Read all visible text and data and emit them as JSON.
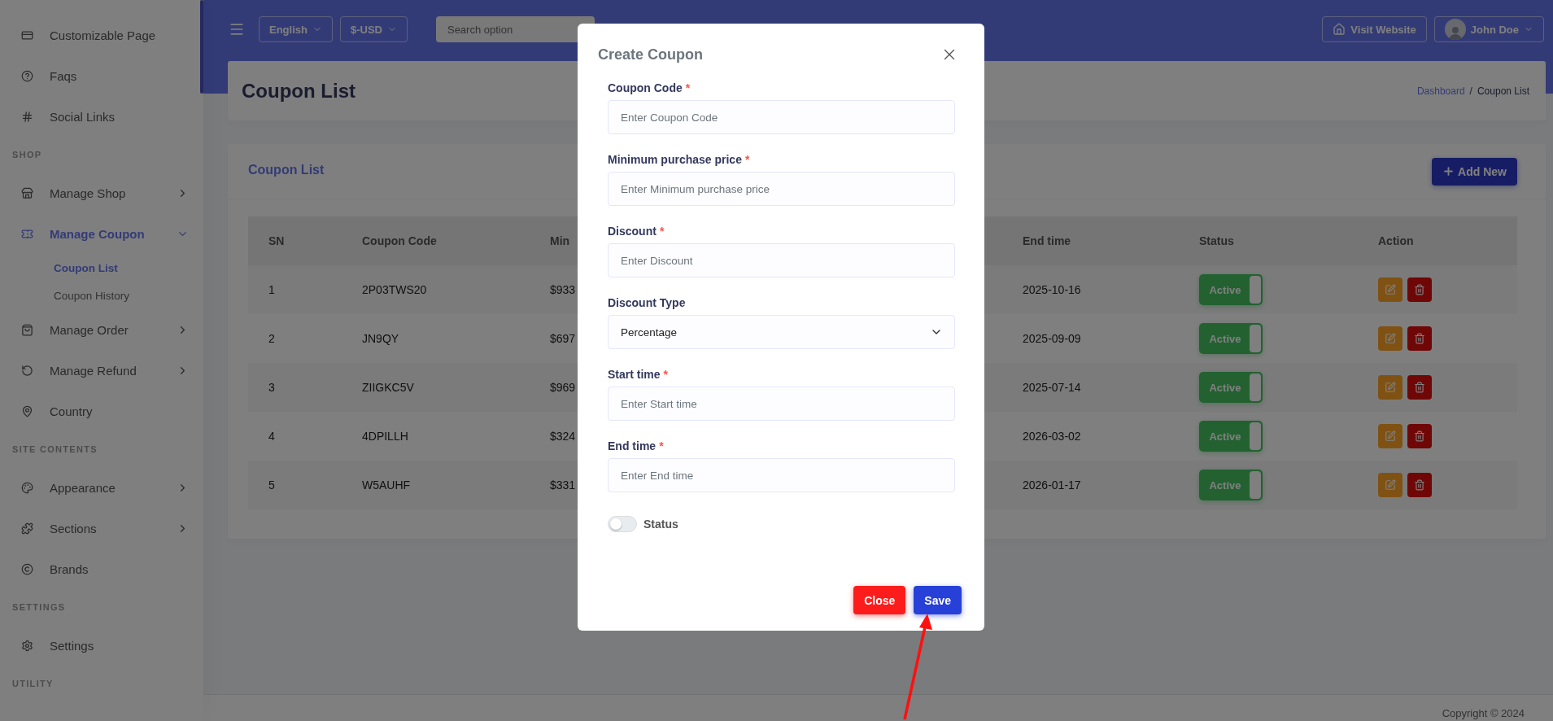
{
  "sidebar": {
    "items": [
      {
        "kind": "item",
        "label": "Customizable Page",
        "selected": false
      },
      {
        "kind": "item",
        "label": "Faqs",
        "selected": false
      },
      {
        "kind": "item",
        "label": "Social Links",
        "selected": false
      },
      {
        "kind": "heading",
        "label": "SHOP"
      },
      {
        "kind": "item",
        "label": "Manage Shop",
        "selected": false,
        "expanded": false
      },
      {
        "kind": "item",
        "label": "Manage Coupon",
        "selected": true,
        "expanded": true,
        "children": [
          {
            "label": "Coupon List",
            "selected": true
          },
          {
            "label": "Coupon History",
            "selected": false
          }
        ]
      },
      {
        "kind": "item",
        "label": "Manage Order",
        "selected": false,
        "expanded": false
      },
      {
        "kind": "item",
        "label": "Manage Refund",
        "selected": false,
        "expanded": false
      },
      {
        "kind": "item",
        "label": "Country",
        "selected": false
      },
      {
        "kind": "heading",
        "label": "SITE CONTENTS"
      },
      {
        "kind": "item",
        "label": "Appearance",
        "selected": false,
        "expanded": false
      },
      {
        "kind": "item",
        "label": "Sections",
        "selected": false,
        "expanded": false
      },
      {
        "kind": "item",
        "label": "Brands",
        "selected": false
      },
      {
        "kind": "heading",
        "label": "SETTINGS"
      },
      {
        "kind": "item",
        "label": "Settings",
        "selected": false
      },
      {
        "kind": "heading",
        "label": "UTILITY"
      }
    ]
  },
  "topbar": {
    "language": "English",
    "currency": "$-USD",
    "search": {
      "placeholder": "Search option"
    },
    "visit_website": "Visit Website",
    "user": "John Doe"
  },
  "page_header": {
    "title": "Coupon List",
    "breadcrumb": [
      {
        "label": "Dashboard",
        "link": true
      },
      {
        "label": "Coupon List",
        "link": false
      }
    ],
    "separator": "/"
  },
  "card": {
    "title": "Coupon List",
    "add_button": "Add New"
  },
  "table": {
    "columns": [
      "SN",
      "Coupon Code",
      "Min",
      "End time",
      "Status",
      "Action"
    ],
    "rows": [
      {
        "sn": "1",
        "code": "2P03TWS20",
        "column_3": "$933",
        "end_time": "2025-10-16",
        "status": {
          "label": "Active",
          "on": true
        }
      },
      {
        "sn": "2",
        "code": "JN9QY",
        "column_3": "$697",
        "end_time": "2025-09-09",
        "status": {
          "label": "Active",
          "on": true
        }
      },
      {
        "sn": "3",
        "code": "ZIIGKC5V",
        "column_3": "$969",
        "end_time": "2025-07-14",
        "status": {
          "label": "Active",
          "on": true
        }
      },
      {
        "sn": "4",
        "code": "4DPILLH",
        "column_3": "$324",
        "end_time": "2026-03-02",
        "status": {
          "label": "Active",
          "on": true
        }
      },
      {
        "sn": "5",
        "code": "W5AUHF",
        "column_3": "$331",
        "end_time": "2026-01-17",
        "status": {
          "label": "Active",
          "on": true
        }
      }
    ]
  },
  "footer": {
    "copyright": "Copyright © 2024"
  },
  "modal": {
    "title": "Create Coupon",
    "fields": [
      {
        "kind": "input",
        "label": "Coupon Code",
        "required_mark": "*",
        "placeholder": "Enter Coupon Code"
      },
      {
        "kind": "input",
        "label": "Minimum purchase price",
        "required_mark": "*",
        "placeholder": "Enter Minimum purchase price"
      },
      {
        "kind": "input",
        "label": "Discount",
        "required_mark": "*",
        "placeholder": "Enter Discount"
      },
      {
        "kind": "select",
        "label": "Discount Type",
        "value": "Percentage"
      },
      {
        "kind": "input",
        "label": "Start time",
        "required_mark": "*",
        "placeholder": "Enter Start time"
      },
      {
        "kind": "input",
        "label": "End time",
        "required_mark": "*",
        "placeholder": "Enter End time"
      }
    ],
    "status": {
      "label": "Status",
      "on": false
    },
    "buttons": [
      {
        "kind": "close",
        "label": "Close"
      },
      {
        "kind": "save",
        "label": "Save"
      }
    ]
  }
}
